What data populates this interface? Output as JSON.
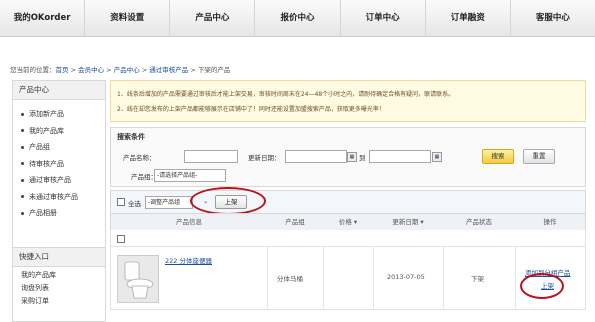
{
  "topnav": {
    "items": [
      "我的OKorder",
      "资料设置",
      "产品中心",
      "报价中心",
      "订单中心",
      "订单融资",
      "客服中心"
    ]
  },
  "breadcrumb": {
    "prefix": "您当前的位置：",
    "home": "首页",
    "member": "会员中心",
    "products": "产品中心",
    "approved": "通过审核产品",
    "current": "下架的产品",
    "sep": " > "
  },
  "sidebar": {
    "title": "产品中心",
    "items": [
      "添加新产品",
      "我的产品库",
      "产品组",
      "待审核产品",
      "通过审核产品",
      "未通过审核产品",
      "产品相册"
    ],
    "quick_title": "快捷入口",
    "quick_items": [
      "我的产品库",
      "询盘列表",
      "采购订单"
    ]
  },
  "notice": {
    "line1": "1、线条后增加的产品需要通过审核后才能上架交易，审核时间周末在24—48个小时之内，请耐待确定合格有疑问，联请联系。",
    "line2": "2、线在却您发布的上架产品都能够展示在店铺中了！同时还能设置加盟搜索产品，获取更多曝光率！"
  },
  "search": {
    "title": "搜索条件",
    "name_label": "产品名称：",
    "date_label": "更新日期：",
    "to_label": "到",
    "group_label": "产品组：",
    "group_value": "-请选择产品组-",
    "search_button": "搜索",
    "reset_button": "重置"
  },
  "toolbar": {
    "select_all": "全选",
    "group_select": "-调整产品组",
    "shelf_button": "上架"
  },
  "table": {
    "headers": [
      "产品信息",
      "产品组",
      "价格",
      "更新日期",
      "产品状态",
      "操作"
    ],
    "rows": [
      {
        "name": "222 分体座便器",
        "group": "分体马桶",
        "price": "",
        "date": "2013-07-05",
        "status": "下架",
        "action_add_group": "添加到分组产品",
        "action_shelf": "上架"
      }
    ]
  },
  "colors": {
    "highlight": "#b8121b",
    "link": "#1a4fa0",
    "search_button": "#f5c842",
    "notice_bg": "#fffbe3"
  }
}
